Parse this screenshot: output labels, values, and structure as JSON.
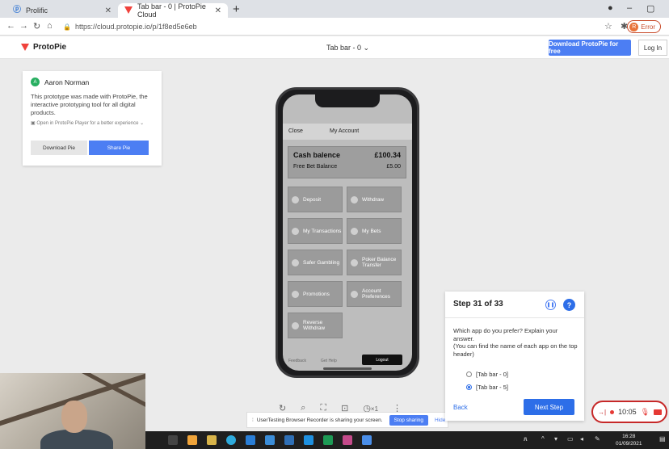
{
  "browser": {
    "tabs": [
      {
        "title": "Prolific"
      },
      {
        "title": "Tab bar - 0 | ProtoPie Cloud"
      }
    ],
    "new_tab_symbol": "+",
    "url": "https://cloud.protopie.io/p/1f8ed5e6eb",
    "error_label": "Error",
    "error_avatar": "R",
    "window_controls": [
      "–",
      "▢"
    ]
  },
  "protopie": {
    "logo": "ProtoPie",
    "prototype_title": "Tab bar - 0 ⌄",
    "download_button": "Download ProtoPie for free",
    "login_button": "Log In"
  },
  "info_card": {
    "author_initial": "A",
    "author_name": "Aaron Norman",
    "description": "This prototype was made with ProtoPie, the interactive prototyping tool for all digital products.",
    "open_in_player": "Open in ProtoPie Player for a better experience ⌄",
    "download_pie": "Download Pie",
    "share_pie": "Share Pie"
  },
  "phone_app": {
    "close": "Close",
    "title": "My Account",
    "cash_balence_label": "Cash balence",
    "cash_balence_value": "£100.34",
    "free_bet_label": "Free Bet Balance",
    "free_bet_value": "£5.00",
    "menu": [
      "Deposit",
      "Withdraw",
      "My Transactions",
      "My Bets",
      "Safer Gambling",
      "Poker Balance Transfer",
      "Promotions",
      "Account Preferences",
      "Reverse Withdraw"
    ],
    "feedback": "Feedback",
    "get_help": "Get Help",
    "logout": "Logout"
  },
  "player_controls": {
    "speed": "×1"
  },
  "share_bar": {
    "message": "UserTesting Browser Recorder is sharing your screen.",
    "stop_sharing": "Stop sharing",
    "hide": "Hide"
  },
  "step_panel": {
    "title": "Step 31 of 33",
    "question": "Which app do you prefer? Explain your answer.\n(You can find the name of each app on the top header)",
    "options": [
      {
        "label": "[Tab bar - 0]",
        "selected": false
      },
      {
        "label": "[Tab bar - 5]",
        "selected": true
      }
    ],
    "back": "Back",
    "next_step": "Next Step"
  },
  "recorder": {
    "timer": "10:05"
  },
  "taskbar": {
    "time": "16:28",
    "date": "01/09/2021"
  },
  "colors": {
    "accent": "#4c7ef3",
    "step_blue": "#2d6ee8",
    "record_red": "#e53935"
  }
}
